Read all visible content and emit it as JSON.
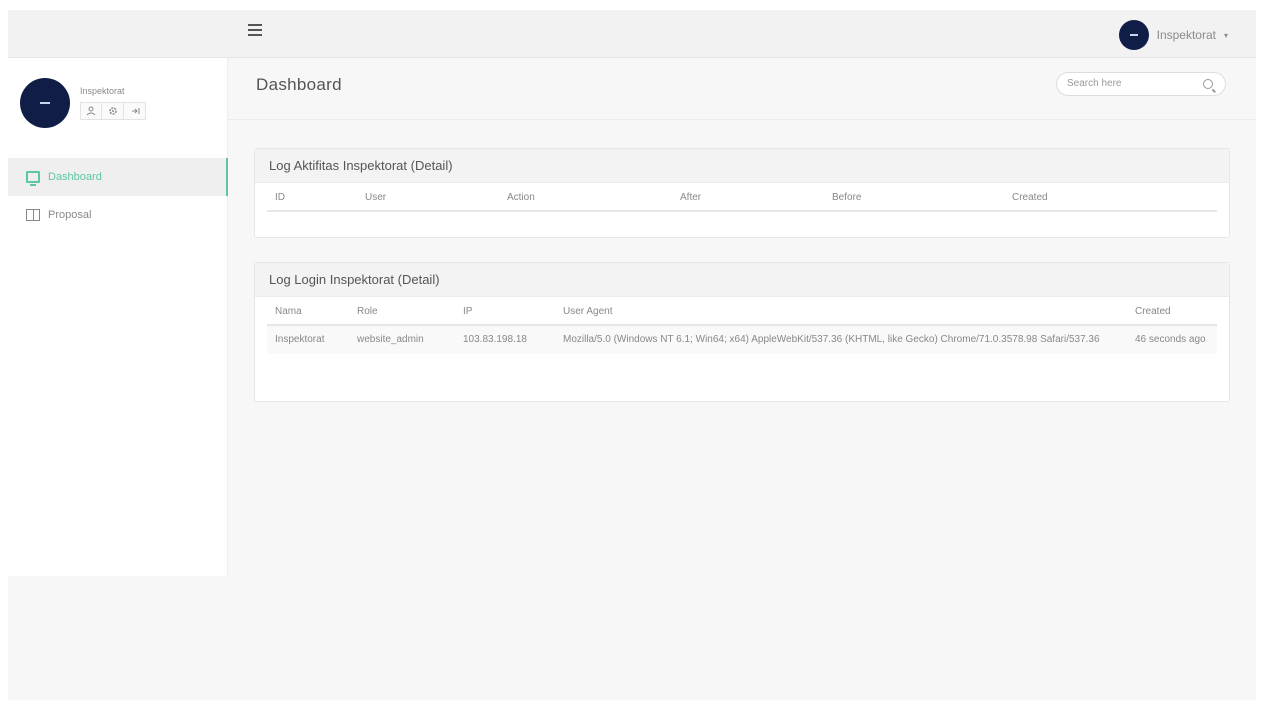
{
  "topbar": {
    "user_name": "Inspektorat",
    "caret": "▾"
  },
  "sidebar": {
    "profile_name": "Inspektorat",
    "profile_actions": [
      "user-icon",
      "gear-icon",
      "logout-icon"
    ],
    "items": [
      {
        "label": "Dashboard",
        "icon": "monitor-icon",
        "active": true
      },
      {
        "label": "Proposal",
        "icon": "book-icon",
        "active": false
      }
    ]
  },
  "page": {
    "title": "Dashboard",
    "search_placeholder": "Search here"
  },
  "log_aktifitas": {
    "title": "Log Aktifitas Inspektorat (Detail)",
    "columns": [
      "ID",
      "User",
      "Action",
      "After",
      "Before",
      "Created"
    ],
    "rows": []
  },
  "log_login": {
    "title": "Log Login Inspektorat (Detail)",
    "columns": [
      "Nama",
      "Role",
      "IP",
      "User Agent",
      "Created"
    ],
    "rows": [
      {
        "nama": "Inspektorat",
        "role": "website_admin",
        "ip": "103.83.198.18",
        "user_agent": "Mozilla/5.0 (Windows NT 6.1; Win64; x64) AppleWebKit/537.36 (KHTML, like Gecko) Chrome/71.0.3578.98 Safari/537.36",
        "created": "46 seconds ago"
      }
    ]
  },
  "colors": {
    "accent": "#5fc6a4",
    "avatar": "#0f1d47"
  }
}
